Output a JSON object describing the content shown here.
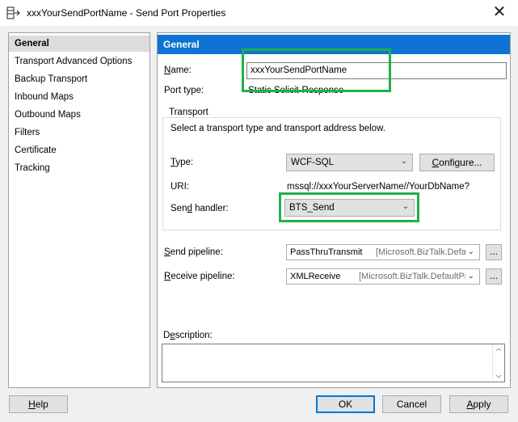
{
  "window": {
    "title": "xxxYourSendPortName - Send Port Properties",
    "close_glyph": "✕"
  },
  "nav": {
    "items": [
      {
        "label": "General",
        "selected": true
      },
      {
        "label": "Transport Advanced Options"
      },
      {
        "label": "Backup Transport"
      },
      {
        "label": "Inbound Maps"
      },
      {
        "label": "Outbound Maps"
      },
      {
        "label": "Filters"
      },
      {
        "label": "Certificate"
      },
      {
        "label": "Tracking"
      }
    ]
  },
  "panel": {
    "header": "General",
    "name_label_first": "N",
    "name_label_rest": "ame:",
    "name_value": "xxxYourSendPortName",
    "port_type_label": "Port type:",
    "port_type_value": "Static Solicit-Response",
    "transport": {
      "group_title": "Transport",
      "hint": "Select a transport type and transport address below.",
      "type_label_first": "T",
      "type_label_rest": "ype:",
      "type_value": "WCF-SQL",
      "configure_first": "C",
      "configure_rest": "onfigure...",
      "uri_label": "URI:",
      "uri_value": "mssql://xxxYourServerName//YourDbName?",
      "send_handler_label_a": "Sen",
      "send_handler_label_u": "d",
      "send_handler_label_b": " handler:",
      "send_handler_value": "BTS_Send"
    },
    "send_pipeline_label_first": "S",
    "send_pipeline_label_rest": "end pipeline:",
    "send_pipeline_name": "PassThruTransmit",
    "send_pipeline_assembly": "[Microsoft.BizTalk.Defa",
    "receive_pipeline_label_first": "R",
    "receive_pipeline_label_rest": "eceive pipeline:",
    "receive_pipeline_name": "XMLReceive",
    "receive_pipeline_assembly": "[Microsoft.BizTalk.DefaultPip",
    "browse_label": "...",
    "description_label_a": "D",
    "description_label_u": "e",
    "description_label_b": "scription:",
    "description_value": ""
  },
  "footer": {
    "help_first": "H",
    "help_rest": "elp",
    "ok": "OK",
    "cancel": "Cancel",
    "apply_first": "A",
    "apply_rest": "pply"
  },
  "colors": {
    "header_blue": "#0e73d3",
    "highlight_green": "#21b04b",
    "selection_gray": "#dcdcdc"
  }
}
